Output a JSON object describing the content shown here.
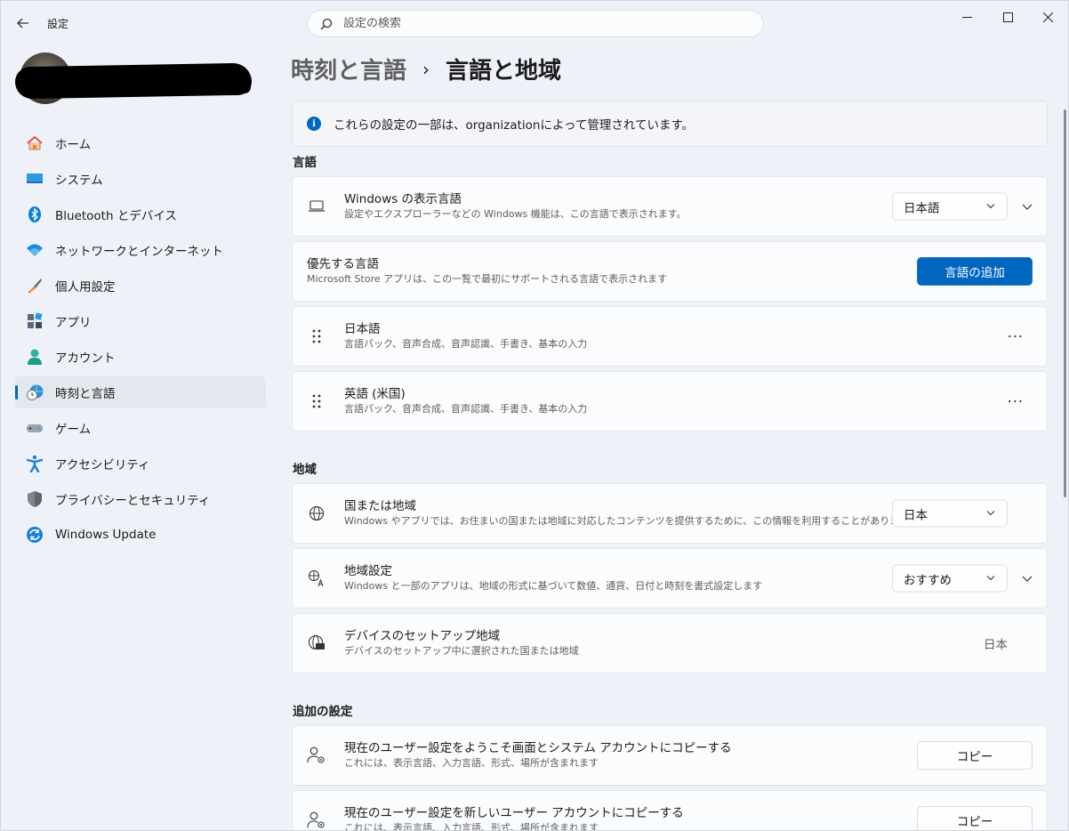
{
  "app": {
    "title": "設定"
  },
  "search": {
    "placeholder": "設定の検索"
  },
  "window_controls": {
    "minimize": "—",
    "maximize": "☐",
    "close": "✕"
  },
  "sidebar": {
    "items": [
      {
        "label": "ホーム",
        "icon": "home-icon"
      },
      {
        "label": "システム",
        "icon": "system-icon"
      },
      {
        "label": "Bluetooth とデバイス",
        "icon": "bluetooth-icon"
      },
      {
        "label": "ネットワークとインターネット",
        "icon": "wifi-icon"
      },
      {
        "label": "個人用設定",
        "icon": "brush-icon"
      },
      {
        "label": "アプリ",
        "icon": "apps-icon"
      },
      {
        "label": "アカウント",
        "icon": "account-icon"
      },
      {
        "label": "時刻と言語",
        "icon": "time-language-icon",
        "active": true
      },
      {
        "label": "ゲーム",
        "icon": "gamepad-icon"
      },
      {
        "label": "アクセシビリティ",
        "icon": "accessibility-icon"
      },
      {
        "label": "プライバシーとセキュリティ",
        "icon": "shield-icon"
      },
      {
        "label": "Windows Update",
        "icon": "update-icon"
      }
    ]
  },
  "breadcrumb": {
    "parent": "時刻と言語",
    "separator": "›",
    "current": "言語と地域"
  },
  "notice": {
    "text": "これらの設定の一部は、organizationによって管理されています。"
  },
  "language_section": {
    "title": "言語",
    "display_language": {
      "title": "Windows の表示言語",
      "desc": "設定やエクスプローラーなどの Windows 機能は、この言語で表示されます。",
      "value": "日本語"
    },
    "preferred": {
      "title": "優先する言語",
      "desc": "Microsoft Store アプリは、この一覧で最初にサポートされる言語で表示されます",
      "button": "言語の追加"
    },
    "languages": [
      {
        "title": "日本語",
        "desc": "言語パック、音声合成、音声認識、手書き、基本の入力",
        "more": "···"
      },
      {
        "title": "英語 (米国)",
        "desc": "言語パック、音声合成、音声認識、手書き、基本の入力",
        "more": "···"
      }
    ]
  },
  "region_section": {
    "title": "地域",
    "country": {
      "title": "国または地域",
      "desc": "Windows やアプリでは、お住まいの国または地域に対応したコンテンツを提供するために、この情報を利用することがあります",
      "value": "日本"
    },
    "format": {
      "title": "地域設定",
      "desc": "Windows と一部のアプリは、地域の形式に基づいて数値、通貨、日付と時刻を書式設定します",
      "value": "おすすめ"
    },
    "setup_region": {
      "title": "デバイスのセットアップ地域",
      "desc": "デバイスのセットアップ中に選択された国または地域",
      "value": "日本"
    }
  },
  "additional_section": {
    "title": "追加の設定",
    "items": [
      {
        "title": "現在のユーザー設定をようこそ画面とシステム アカウントにコピーする",
        "desc": "これには、表示言語、入力言語、形式、場所が含まれます",
        "button": "コピー"
      },
      {
        "title": "現在のユーザー設定を新しいユーザー アカウントにコピーする",
        "desc": "これには、表示言語、入力言語、形式、場所が含まれます",
        "button": "コピー"
      }
    ]
  },
  "colors": {
    "accent": "#0067c0",
    "background": "#eef2f8",
    "card": "#fbfcfd"
  }
}
